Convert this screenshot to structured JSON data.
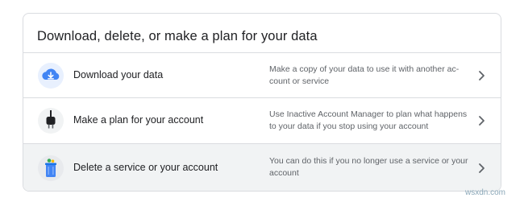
{
  "card": {
    "title": "Download, delete, or make a plan for your data"
  },
  "rows": [
    {
      "title": "Download your data",
      "description": "Make a copy of your data to use it with another ac-count or service",
      "icon": "cloud-download-icon",
      "icon_color": "#4285f4"
    },
    {
      "title": "Make a plan for your account",
      "description": "Use Inactive Account Manager to plan what happens to your data if you stop using your account",
      "icon": "power-plug-icon",
      "icon_color": "#202124"
    },
    {
      "title": "Delete a service or your account",
      "description": "You can do this if you no longer use a service or your account",
      "icon": "trash-can-icon",
      "icon_color": "#4285f4"
    }
  ],
  "watermark": "wsxdn.com"
}
